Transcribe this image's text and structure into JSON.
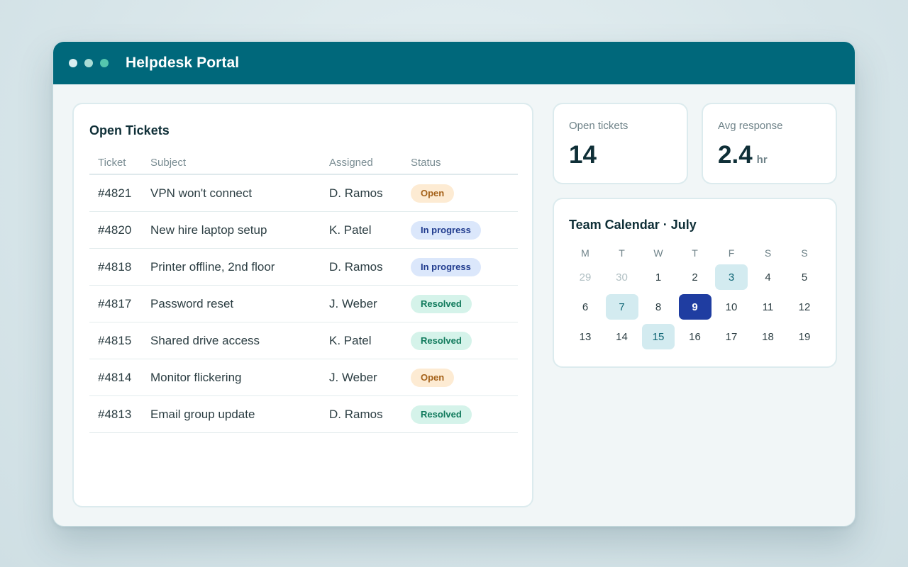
{
  "window": {
    "title": "Helpdesk Portal"
  },
  "tickets": {
    "title": "Open Tickets",
    "headers": {
      "ticket": "Ticket",
      "subject": "Subject",
      "assigned": "Assigned",
      "status": "Status"
    },
    "rows": [
      {
        "id": "#4821",
        "subject": "VPN won't connect",
        "assigned": "D. Ramos",
        "status": "Open"
      },
      {
        "id": "#4820",
        "subject": "New hire laptop setup",
        "assigned": "K. Patel",
        "status": "In progress"
      },
      {
        "id": "#4818",
        "subject": "Printer offline, 2nd floor",
        "assigned": "D. Ramos",
        "status": "In progress"
      },
      {
        "id": "#4817",
        "subject": "Password reset",
        "assigned": "J. Weber",
        "status": "Resolved"
      },
      {
        "id": "#4815",
        "subject": "Shared drive access",
        "assigned": "K. Patel",
        "status": "Resolved"
      },
      {
        "id": "#4814",
        "subject": "Monitor flickering",
        "assigned": "J. Weber",
        "status": "Open"
      },
      {
        "id": "#4813",
        "subject": "Email group update",
        "assigned": "D. Ramos",
        "status": "Resolved"
      }
    ]
  },
  "stats": {
    "open": {
      "label": "Open tickets",
      "value": "14"
    },
    "avg": {
      "label": "Avg response",
      "value": "2.4",
      "unit": "hr"
    }
  },
  "calendar": {
    "title": "Team Calendar · July",
    "weekdays": [
      "M",
      "T",
      "W",
      "T",
      "F",
      "S",
      "S"
    ],
    "days": [
      {
        "n": "29",
        "state": "muted"
      },
      {
        "n": "30",
        "state": "muted"
      },
      {
        "n": "1",
        "state": ""
      },
      {
        "n": "2",
        "state": ""
      },
      {
        "n": "3",
        "state": "hl"
      },
      {
        "n": "4",
        "state": ""
      },
      {
        "n": "5",
        "state": ""
      },
      {
        "n": "6",
        "state": ""
      },
      {
        "n": "7",
        "state": "hl"
      },
      {
        "n": "8",
        "state": ""
      },
      {
        "n": "9",
        "state": "today"
      },
      {
        "n": "10",
        "state": ""
      },
      {
        "n": "11",
        "state": ""
      },
      {
        "n": "12",
        "state": ""
      },
      {
        "n": "13",
        "state": ""
      },
      {
        "n": "14",
        "state": ""
      },
      {
        "n": "15",
        "state": "hl"
      },
      {
        "n": "16",
        "state": ""
      },
      {
        "n": "17",
        "state": ""
      },
      {
        "n": "18",
        "state": ""
      },
      {
        "n": "19",
        "state": ""
      }
    ]
  },
  "colors": {
    "titlebar": "#00687b",
    "today": "#1f3da1",
    "highlight": "#d3ebf0",
    "status_open": "#fdebd3",
    "status_progress": "#dbe7fb",
    "status_resolved": "#d5f3ea"
  }
}
